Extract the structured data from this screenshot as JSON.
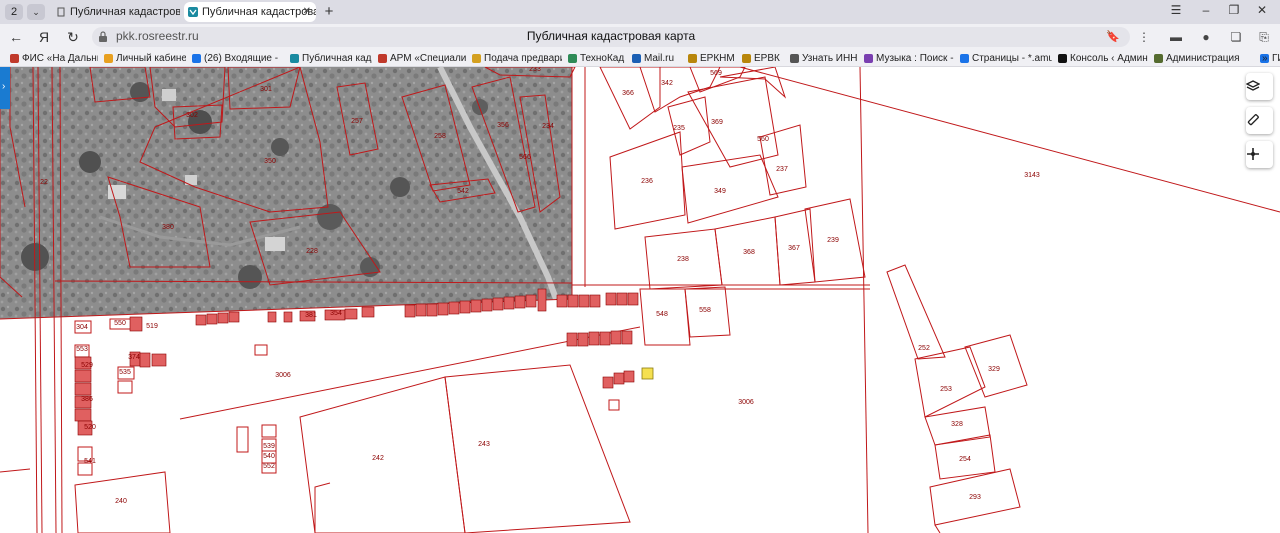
{
  "browser": {
    "tab_count": "2",
    "tabs": [
      {
        "title": "Публичная кадастровая",
        "active": false
      },
      {
        "title": "Публичная кадастровая",
        "active": true
      }
    ],
    "url": "pkk.rosreestr.ru",
    "page_title": "Публичная кадастровая карта"
  },
  "bookmarks": [
    {
      "label": "ФИС «На Дальни",
      "icon_color": "#c0392b"
    },
    {
      "label": "Личный кабинет",
      "icon_color": "#e8a020"
    },
    {
      "label": "(26) Входящие -",
      "icon_color": "#1a73e8"
    },
    {
      "label": "Публичная кадас",
      "icon_color": "#1a8aa0"
    },
    {
      "label": "АРМ «Специалис",
      "icon_color": "#c0392b"
    },
    {
      "label": "Подача предвари",
      "icon_color": "#d4a020"
    },
    {
      "label": "ТехноКад",
      "icon_color": "#2e8b57"
    },
    {
      "label": "Mail.ru",
      "icon_color": "#1a5fb4"
    },
    {
      "label": "ЕРКНМ",
      "icon_color": "#b8860b"
    },
    {
      "label": "ЕРВК",
      "icon_color": "#b8860b"
    },
    {
      "label": "Узнать ИНН",
      "icon_color": "#555555"
    },
    {
      "label": "Музыка : Поиск -",
      "icon_color": "#7a3fb0"
    },
    {
      "label": "Страницы - *.amu",
      "icon_color": "#1a73e8"
    },
    {
      "label": "Консоль ‹ Админ",
      "icon_color": "#111111"
    },
    {
      "label": "Администрация",
      "icon_color": "#556b2f"
    },
    {
      "label": "ГИС",
      "icon_color": "#1a73e8"
    }
  ],
  "map_controls": {
    "layers_icon": "layers-icon",
    "ruler_icon": "ruler-icon",
    "locate_icon": "crosshair-icon"
  },
  "parcels": [
    "301",
    "302",
    "257",
    "258",
    "356",
    "234",
    "350",
    "566",
    "542",
    "380",
    "228",
    "22",
    "233",
    "569",
    "366",
    "342",
    "235",
    "369",
    "560",
    "237",
    "236",
    "349",
    "238",
    "368",
    "367",
    "239",
    "3143",
    "548",
    "558",
    "550",
    "519",
    "304",
    "354",
    "381",
    "553",
    "529",
    "374",
    "386",
    "535",
    "3006",
    "243",
    "242",
    "240",
    "520",
    "539",
    "540",
    "552",
    "541",
    "252",
    "253",
    "329",
    "328",
    "254",
    "293",
    "3006"
  ],
  "colors": {
    "parcel_line": "#c0181a",
    "parcel_fill": "#e06060",
    "highlight": "#f5e050"
  }
}
